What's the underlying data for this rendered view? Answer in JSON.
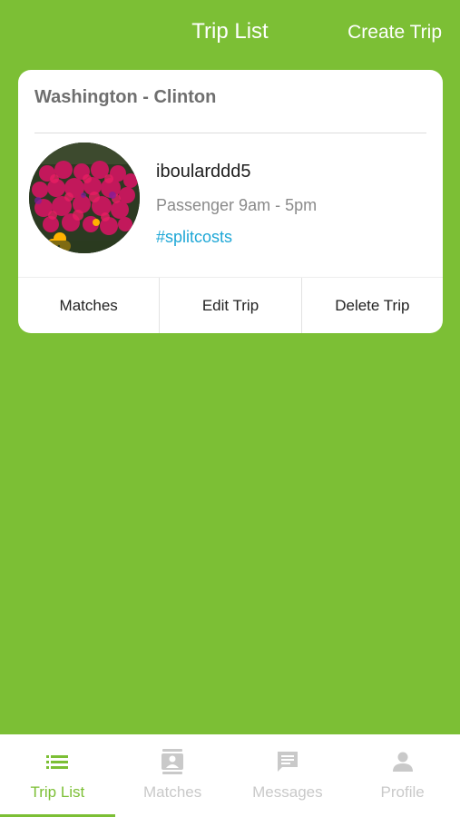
{
  "header": {
    "title": "Trip List",
    "action_label": "Create Trip"
  },
  "trip_card": {
    "route": "Washington - Clinton",
    "user": {
      "name": "iboularddd5",
      "role_time": "Passenger  9am - 5pm",
      "tag": "#splitcosts",
      "avatar_icon": "flower-photo-avatar"
    },
    "actions": [
      {
        "label": "Matches"
      },
      {
        "label": "Edit Trip"
      },
      {
        "label": "Delete Trip"
      }
    ]
  },
  "tabbar": {
    "active_index": 0,
    "tabs": [
      {
        "label": "Trip List",
        "icon": "list-icon"
      },
      {
        "label": "Matches",
        "icon": "contact-card-icon"
      },
      {
        "label": "Messages",
        "icon": "message-icon"
      },
      {
        "label": "Profile",
        "icon": "person-icon"
      }
    ]
  },
  "colors": {
    "brand_green": "#7cbf35",
    "link_blue": "#1ea7d6",
    "inactive_tab": "#c9c9c9"
  }
}
